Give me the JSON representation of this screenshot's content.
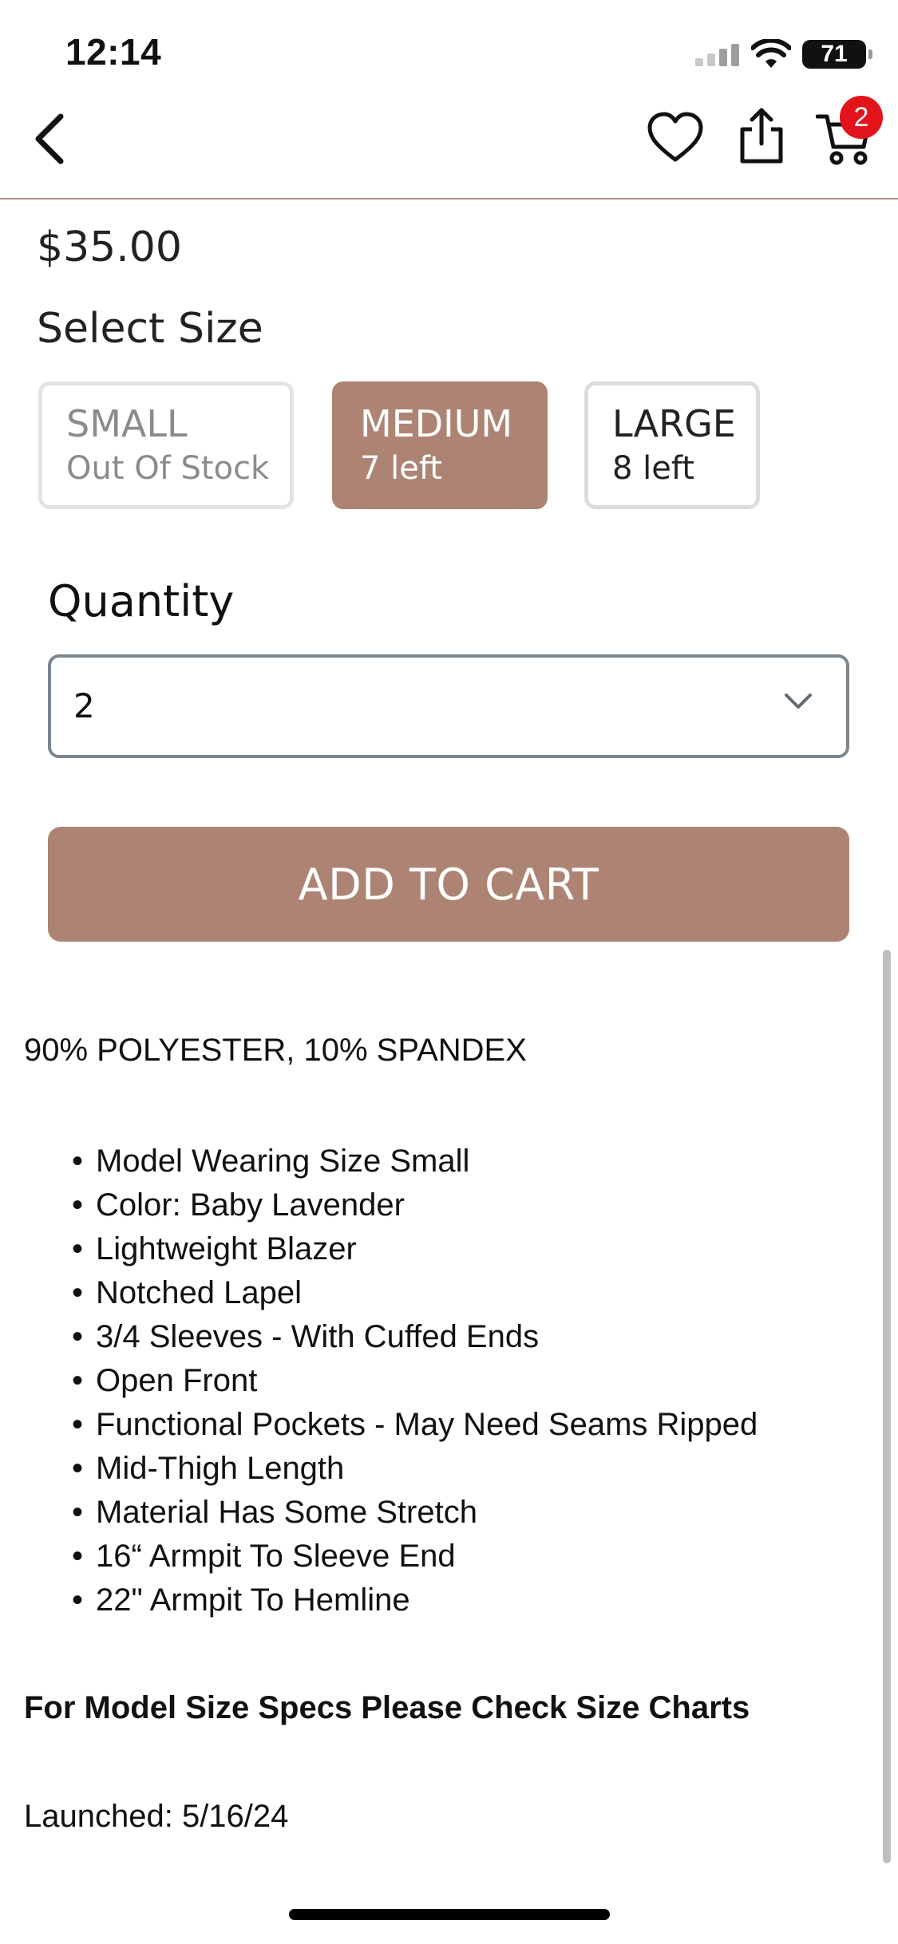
{
  "status_bar": {
    "time": "12:14",
    "battery": "71"
  },
  "header": {
    "cart_count": "2"
  },
  "product": {
    "price": "$35.00",
    "select_size_label": "Select Size",
    "sizes": [
      {
        "name": "SMALL",
        "stock": "Out Of Stock",
        "selected": false,
        "available": false
      },
      {
        "name": "MEDIUM",
        "stock": "7 left",
        "selected": true,
        "available": true
      },
      {
        "name": "LARGE",
        "stock": "8 left",
        "selected": false,
        "available": true
      }
    ],
    "quantity_label": "Quantity",
    "quantity_value": "2",
    "add_to_cart_label": "ADD TO CART"
  },
  "description": {
    "material": "90% POLYESTER, 10% SPANDEX",
    "features": [
      "Model Wearing Size Small",
      "Color: Baby Lavender",
      "Lightweight Blazer",
      "Notched Lapel",
      "3/4 Sleeves - With Cuffed Ends",
      "Open Front",
      "Functional Pockets - May Need Seams Ripped",
      "Mid-Thigh Length",
      "Material Has Some Stretch",
      "16“ Armpit To Sleeve End",
      "22\" Armpit To Hemline"
    ],
    "model_note": "For Model Size Specs Please Check Size Charts",
    "launched": "Launched: 5/16/24"
  },
  "colors": {
    "accent": "#ad8473",
    "badge": "#e3131b",
    "divider": "#b8958a"
  },
  "icons": {
    "back": "chevron-left-icon",
    "wishlist": "heart-icon",
    "share": "share-icon",
    "cart": "cart-icon",
    "dropdown": "chevron-down-icon"
  }
}
